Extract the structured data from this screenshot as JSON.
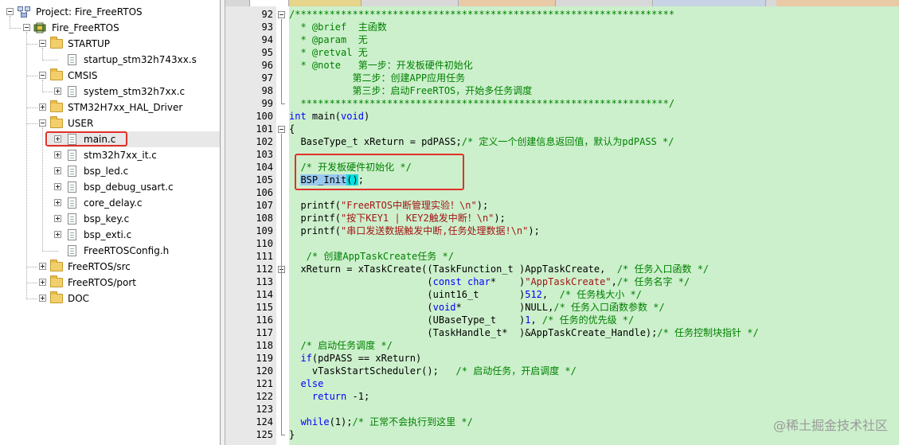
{
  "project_tree": {
    "project_label": "Project: Fire_FreeRTOS",
    "target_label": "Fire_FreeRTOS",
    "groups": [
      {
        "label": "STARTUP",
        "files": [
          "startup_stm32h743xx.s"
        ]
      },
      {
        "label": "CMSIS",
        "files": [
          "system_stm32h7xx.c"
        ]
      },
      {
        "label": "STM32H7xx_HAL_Driver",
        "files": []
      },
      {
        "label": "USER",
        "files": [
          "main.c",
          "stm32h7xx_it.c",
          "bsp_led.c",
          "bsp_debug_usart.c",
          "core_delay.c",
          "bsp_key.c",
          "bsp_exti.c",
          "FreeRTOSConfig.h"
        ]
      },
      {
        "label": "FreeRTOS/src",
        "files": []
      },
      {
        "label": "FreeRTOS/port",
        "files": []
      },
      {
        "label": "DOC",
        "files": []
      }
    ]
  },
  "editor": {
    "line_numbers": [
      "92",
      "93",
      "94",
      "95",
      "96",
      "97",
      "98",
      "99",
      "100",
      "101",
      "102",
      "103",
      "104",
      "105",
      "106",
      "107",
      "108",
      "109",
      "110",
      "111",
      "112",
      "113",
      "114",
      "115",
      "116",
      "117",
      "118",
      "119",
      "120",
      "121",
      "122",
      "123",
      "124",
      "125"
    ],
    "code": {
      "l92": "/******************************************************************",
      "l93": "  * @brief  主函数",
      "l94": "  * @param  无",
      "l95": "  * @retval 无",
      "l96": "  * @note   第一步：开发板硬件初始化",
      "l97": "           第二步：创建APP应用任务",
      "l98": "           第三步：启动FreeRTOS，开始多任务调度",
      "l99": "  ****************************************************************/",
      "l100_kw": "int",
      "l100_rest": " main(",
      "l100_kw2": "void",
      "l100_end": ")",
      "l101": "{",
      "l102_code": "  BaseType_t xReturn = pdPASS;",
      "l102_cm": "/* 定义一个创建信息返回值，默认为pdPASS */",
      "l103": "",
      "l104": "  /* 开发板硬件初始化 */",
      "l105_pre": "  ",
      "l105_sel": "BSP_Init",
      "l105_brk": "()",
      "l105_end": ";",
      "l106": "",
      "l107_pre": "  printf(",
      "l107_str": "\"FreeRTOS中断管理实验！\\n\"",
      "l107_end": ");",
      "l108_pre": "  printf(",
      "l108_str": "\"按下KEY1 | KEY2触发中断！\\n\"",
      "l108_end": ");",
      "l109_pre": "  printf(",
      "l109_str": "\"串口发送数据触发中断,任务处理数据!\\n\"",
      "l109_end": ");",
      "l110": "",
      "l111": "   /* 创建AppTaskCreate任务 */",
      "l112_code": "  xReturn = xTaskCreate((TaskFunction_t )AppTaskCreate,  ",
      "l112_cm": "/* 任务入口函数 */",
      "l113_pre": "                        (",
      "l113_kw": "const char",
      "l113_mid": "*    )",
      "l113_str": "\"AppTaskCreate\"",
      "l113_end": ",",
      "l113_cm": "/* 任务名字 */",
      "l114_pre": "                        (uint16_t       )",
      "l114_num": "512",
      "l114_end": ",  ",
      "l114_cm": "/* 任务栈大小 */",
      "l115_pre": "                        (",
      "l115_kw": "void",
      "l115_mid": "*          )NULL,",
      "l115_cm": "/* 任务入口函数参数 */",
      "l116_pre": "                        (UBaseType_t    )",
      "l116_num": "1",
      "l116_end": ", ",
      "l116_cm": "/* 任务的优先级 */",
      "l117_code": "                        (TaskHandle_t*  )&AppTaskCreate_Handle);",
      "l117_cm": "/* 任务控制块指针 */",
      "l118": "  /* 启动任务调度 */",
      "l119_pre": "  ",
      "l119_kw": "if",
      "l119_end": "(pdPASS == xReturn)",
      "l120_code": "    vTaskStartScheduler();   ",
      "l120_cm": "/* 启动任务，开启调度 */",
      "l121_pre": "  ",
      "l121_kw": "else",
      "l122_pre": "    ",
      "l122_kw": "return",
      "l122_end": " -1;",
      "l123": "",
      "l124_pre": "  ",
      "l124_kw": "while",
      "l124_mid": "(1);",
      "l124_cm": "/* 正常不会执行到这里 */",
      "l125": "}"
    }
  },
  "watermark": "@稀土掘金技术社区",
  "colors": {
    "code_bg": "#ccf0cc",
    "comment": "#008000",
    "keyword": "#0000ff",
    "string": "#a31515",
    "highlight_box": "#e0302a"
  }
}
